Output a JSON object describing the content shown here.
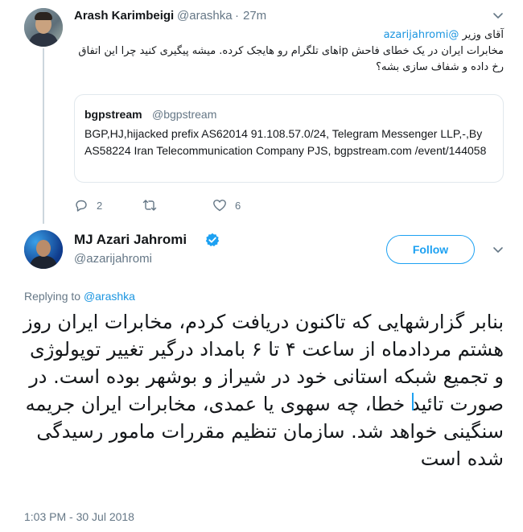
{
  "reply_tweet": {
    "author_name": "Arash Karimbeigi",
    "author_handle": "@arashka",
    "separator": "·",
    "time": "27m",
    "mention": "@azarijahromi",
    "text_line1": "آقای وزیر",
    "text_rest": "مخابرات ایران در یک خطای فاحش ipهای تلگرام رو هایجک کرده. میشه پیگیری کنید چرا این اتفاق رخ داده و شفاف سازی بشه؟",
    "quoted": {
      "author_name": "bgpstream",
      "author_handle": "@bgpstream",
      "text": "BGP,HJ,hijacked prefix AS62014 91.108.57.0/24, Telegram Messenger LLP,-,By AS58224 Iran Telecommunication Company PJS, bgpstream.com /event/144058"
    },
    "actions": {
      "reply_count": "2",
      "retweet_count": "",
      "like_count": "6"
    }
  },
  "main_tweet": {
    "author_name": "MJ Azari Jahromi",
    "author_handle": "@azarijahromi",
    "follow_label": "Follow",
    "replying_prefix": "Replying to",
    "replying_to": "@arashka",
    "text": "بنابر گزارشهایی که تاکنون دریافت کردم، مخابرات ایران روز هشتم مردادماه از ساعت ۴ تا ۶ بامداد درگیر تغییر توپولوژی و تجمیع شبکه استانی خود در شیراز و بوشهر بوده است. در صورت تائید خطا، چه سهوی یا عمدی، مخابرات ایران جریمه سنگینی خواهد شد. سازمان تنظیم مقررات مامور رسیدگی شده است",
    "timestamp": "1:03 PM - 30 Jul 2018"
  },
  "colors": {
    "link": "#1b95e0",
    "accent": "#1da1f2",
    "muted": "#657786",
    "border": "#e1e8ed"
  }
}
